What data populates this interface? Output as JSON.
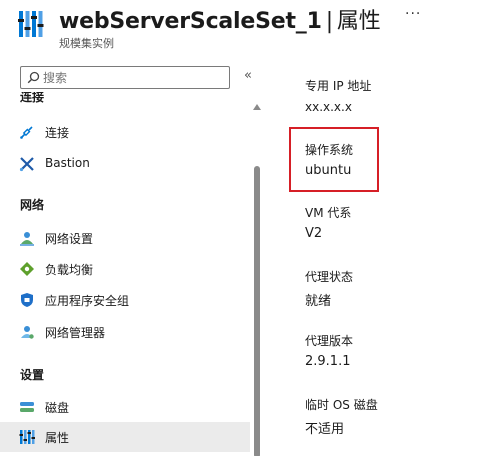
{
  "header": {
    "title": "webServerScaleSet_1",
    "separator": "|",
    "section": "属性",
    "more": "···",
    "subtitle": "规模集实例"
  },
  "search": {
    "placeholder": "搜索"
  },
  "nav": {
    "collapse_glyph": "«",
    "sections": [
      {
        "heading": "连接",
        "items": [
          {
            "label": "连接",
            "icon": "connect-icon"
          },
          {
            "label": "Bastion",
            "icon": "bastion-icon"
          }
        ]
      },
      {
        "heading": "网络",
        "items": [
          {
            "label": "网络设置",
            "icon": "network-settings-icon"
          },
          {
            "label": "负载均衡",
            "icon": "load-balancer-icon"
          },
          {
            "label": "应用程序安全组",
            "icon": "app-security-group-icon"
          },
          {
            "label": "网络管理器",
            "icon": "network-manager-icon"
          }
        ]
      },
      {
        "heading": "设置",
        "items": [
          {
            "label": "磁盘",
            "icon": "disk-icon"
          },
          {
            "label": "属性",
            "icon": "properties-icon",
            "selected": true
          }
        ]
      }
    ]
  },
  "properties": [
    {
      "label": "专用 IP 地址",
      "value": "xx.x.x.x"
    },
    {
      "label": "操作系统",
      "value": "ubuntu",
      "highlighted": true
    },
    {
      "label": "VM 代系",
      "value": "V2"
    },
    {
      "label": "代理状态",
      "value": "就绪"
    },
    {
      "label": "代理版本",
      "value": "2.9.1.1"
    },
    {
      "label": "临时 OS 磁盘",
      "value": "不适用"
    }
  ],
  "colors": {
    "highlight_border": "#d61f26",
    "accent": "#0078d4",
    "selected_bg": "#ebebeb"
  }
}
